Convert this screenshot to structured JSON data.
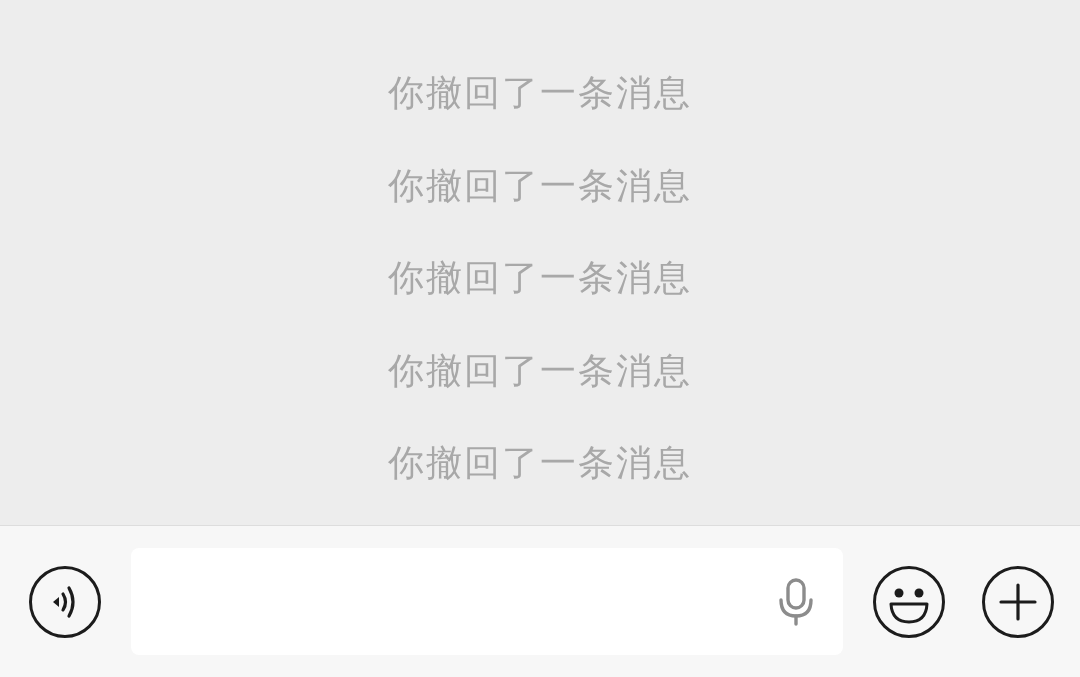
{
  "chat": {
    "notices": [
      "你撤回了一条消息",
      "你撤回了一条消息",
      "你撤回了一条消息",
      "你撤回了一条消息",
      "你撤回了一条消息"
    ]
  }
}
